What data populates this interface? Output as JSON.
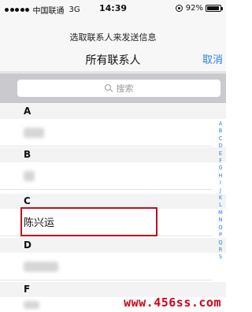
{
  "status_bar": {
    "carrier": "中国联通",
    "network": "3G",
    "time": "14:39",
    "battery": "92%",
    "signal_bars_filled": 5,
    "battery_level": 0.92
  },
  "header": {
    "prompt": "选取联系人来发送信息",
    "title": "所有联系人",
    "cancel_label": "取消"
  },
  "search": {
    "placeholder": "搜索"
  },
  "sections": [
    {
      "letter": "A"
    },
    {
      "letter": "B"
    },
    {
      "letter": "C",
      "contact": "陈兴运"
    },
    {
      "letter": "D"
    },
    {
      "letter": "F"
    }
  ],
  "index_letters": [
    "A",
    "B",
    "C",
    "D",
    "E",
    "F",
    "G",
    "H",
    "I",
    "J",
    "K",
    "L",
    "M",
    "N",
    "O",
    "P",
    "Q",
    "R",
    "S"
  ],
  "watermark": "www.456ss.com",
  "colors": {
    "accent": "#2a7ee6",
    "highlight": "#c0101c",
    "watermark": "#d4001a"
  }
}
